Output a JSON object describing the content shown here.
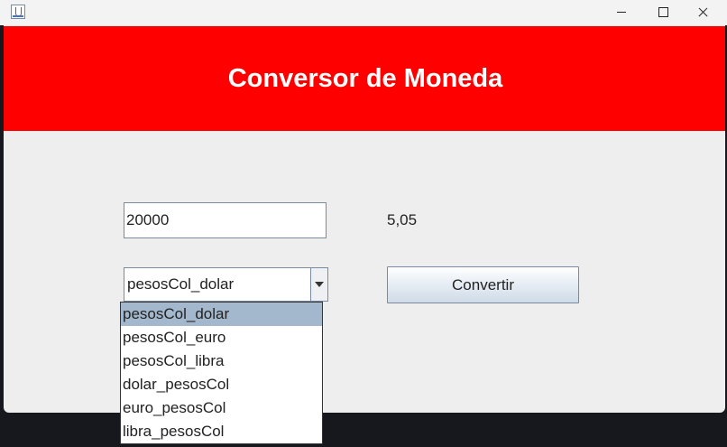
{
  "window": {
    "title": ""
  },
  "header": {
    "title": "Conversor de Moneda",
    "background": "#ff0000"
  },
  "form": {
    "amount_value": "20000",
    "result_value": "5,05",
    "conversion_selected": "pesosCol_dolar",
    "conversion_options": [
      "pesosCol_dolar",
      "pesosCol_euro",
      "pesosCol_libra",
      "dolar_pesosCol",
      "euro_pesosCol",
      "libra_pesosCol"
    ],
    "convert_label": "Convertir"
  },
  "icons": {
    "app": "java-cup-icon",
    "minimize": "minimize-icon",
    "maximize": "maximize-icon",
    "close": "close-icon",
    "dropdown": "chevron-down-icon"
  }
}
